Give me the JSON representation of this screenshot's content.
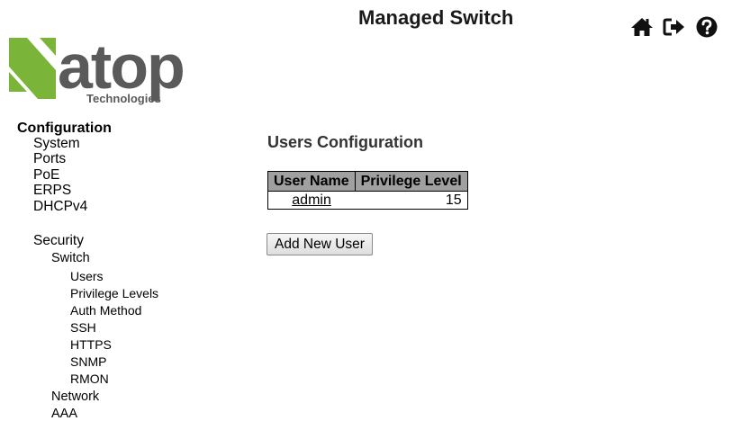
{
  "header": {
    "title": "Managed Switch",
    "icons": [
      "home-icon",
      "logout-icon",
      "help-icon"
    ]
  },
  "logo": {
    "brand": "atop",
    "subtitle": "Technologies",
    "colors": {
      "green": "#7ab53a",
      "gray": "#5a5a5a"
    }
  },
  "nav": {
    "root": "Configuration",
    "items": [
      {
        "label": "System"
      },
      {
        "label": "Ports"
      },
      {
        "label": "PoE"
      },
      {
        "label": "ERPS"
      },
      {
        "label": "DHCPv4"
      },
      {
        "label": "Security"
      },
      {
        "label": "Switch"
      },
      {
        "label": "Users"
      },
      {
        "label": "Privilege Levels"
      },
      {
        "label": "Auth Method"
      },
      {
        "label": "SSH"
      },
      {
        "label": "HTTPS"
      },
      {
        "label": "SNMP"
      },
      {
        "label": "RMON"
      },
      {
        "label": "Network"
      },
      {
        "label": "AAA"
      }
    ]
  },
  "main": {
    "title": "Users Configuration",
    "table": {
      "headers": [
        "User Name",
        "Privilege Level"
      ],
      "rows": [
        {
          "user_name": "admin",
          "privilege_level": "15"
        }
      ]
    },
    "add_button_label": "Add New User"
  }
}
